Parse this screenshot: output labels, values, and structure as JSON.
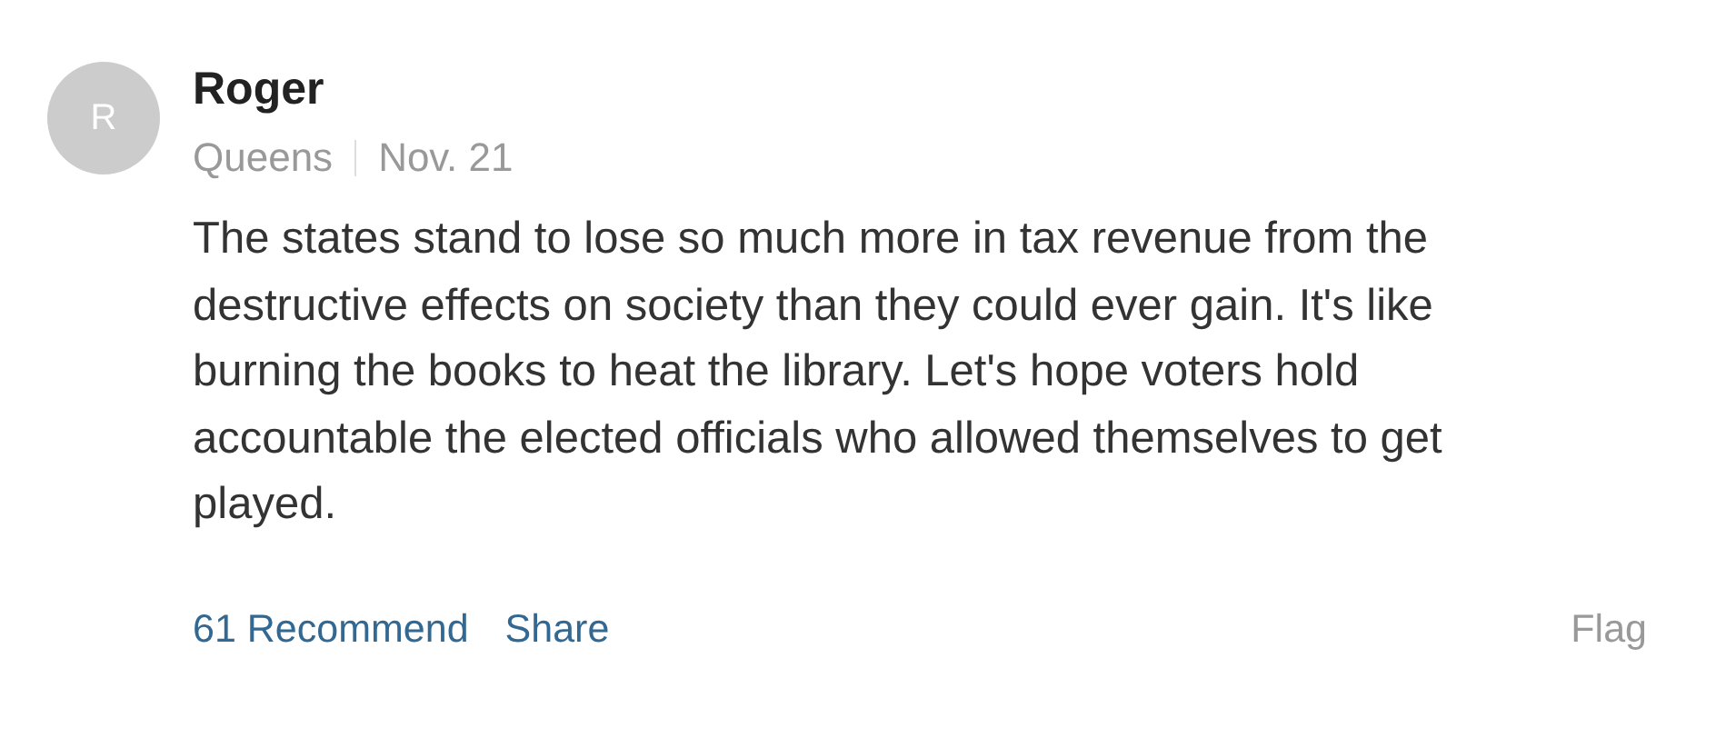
{
  "comment": {
    "avatar_initial": "R",
    "author": "Roger",
    "location": "Queens",
    "date": "Nov. 21",
    "body": "The states stand to lose so much more in tax revenue from the destructive effects on society than they could ever gain. It's like burning the books to heat the library. Let's hope voters hold accountable the elected officials who allowed themselves to get played.",
    "actions": [
      {
        "label": "61 Recommend"
      },
      {
        "label": "Share"
      }
    ],
    "flag": "Flag"
  }
}
